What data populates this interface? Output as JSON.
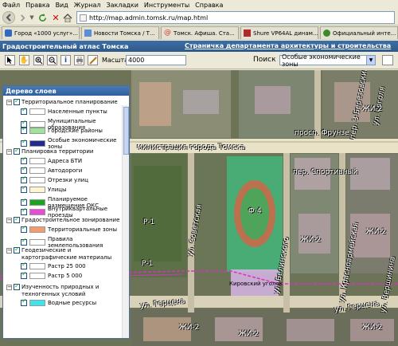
{
  "browser": {
    "menu": [
      "Файл",
      "Правка",
      "Вид",
      "Журнал",
      "Закладки",
      "Инструменты",
      "Справка"
    ],
    "url": "http://map.admin.tomsk.ru/map.html",
    "tabs": [
      {
        "label": "Город «1000 услуг»...",
        "icon_color": "#2f69c1"
      },
      {
        "label": "Новости Томска / Т...",
        "icon_color": "#5a8fd6"
      },
      {
        "label": "Томск. Афиша. Ста...",
        "icon_color": "#d43a2a"
      },
      {
        "label": "Shure VP64AL динам...",
        "icon_color": "#b02a2a"
      },
      {
        "label": "Официальный инте...",
        "icon_color": "#3b8a2d"
      }
    ]
  },
  "atlas": {
    "title": "Градостроительный атлас Томска",
    "dept_link": "Страничка департамента архитектуры и строительства"
  },
  "toolbar": {
    "scale_label": "Масштаб:",
    "scale_value": "4000",
    "search_label": "Поиск",
    "search_value": "Особые экономические зоны"
  },
  "map_labels": {
    "street_frunze": "просп. Фрунзе",
    "admin_label": "министрация города Томска",
    "street_sport": "пер. Спортивный",
    "street_sovet": "ул. Советская",
    "street_krasnoarm": "ул. Красноармейская",
    "street_gertsena": "ул. Герцена",
    "street_gertsena_left": "ул. Герцена",
    "street_gogol": "ул. Гоголя",
    "street_verkh": "ул. Вершинина",
    "street_belin": "ул. Белинского",
    "street_3": "пер. 3-Березовский",
    "zone_f4": "Ф-4",
    "zone_r1a": "Р-1",
    "zone_r1b": "Р-1",
    "zone_zh2a": "ЖИ-2",
    "zone_zh2b": "ЖИ-2",
    "zone_zh2c": "ЖИ-2",
    "zone_zh2d": "ЖИ-2",
    "zone_zh2e": "ЖИ-2",
    "zone_zh2f": "ЖИ-2",
    "kirov_sq": "Кировский уголок"
  },
  "layers": {
    "title": "Дерево слоев",
    "groups": [
      {
        "label": "Территориальное планирование",
        "items": [
          {
            "label": "Населенные пункты",
            "color": "#ffffff"
          },
          {
            "label": "Муниципальные образования",
            "color": "#ffffff"
          },
          {
            "label": "Городские районы",
            "color": "#9de39b"
          },
          {
            "label": "Особые экономические зоны",
            "color": "#1f2a8c"
          }
        ]
      },
      {
        "label": "Планировка территории",
        "items": [
          {
            "label": "Адреса БТИ",
            "color": "#ffffff"
          },
          {
            "label": "Автодороги",
            "color": "#ffffff"
          },
          {
            "label": "Отрезки улиц",
            "color": "#ffffff"
          },
          {
            "label": "Улицы",
            "color": "#fff6d0"
          },
          {
            "label": "Планируемое размещение ОКС",
            "color": "#19a61f"
          },
          {
            "label": "Внутриквартальные проезды",
            "color": "#e94ad7"
          }
        ]
      },
      {
        "label": "Градостроительное зонирование",
        "items": [
          {
            "label": "Территориальные зоны",
            "color": "#f59b6d"
          },
          {
            "label": "Правила землепользования",
            "color": "#ffffff"
          }
        ]
      },
      {
        "label": "Геодезические и картографические материалы",
        "items": [
          {
            "label": "Растр 25 000",
            "color": "#ffffff"
          },
          {
            "label": "Растр 5 000",
            "color": "#ffffff"
          }
        ]
      },
      {
        "label": "Изученность природных и техногенных условий",
        "items": [
          {
            "label": "Водные ресурсы",
            "color": "#3ee3ec"
          }
        ]
      }
    ]
  }
}
